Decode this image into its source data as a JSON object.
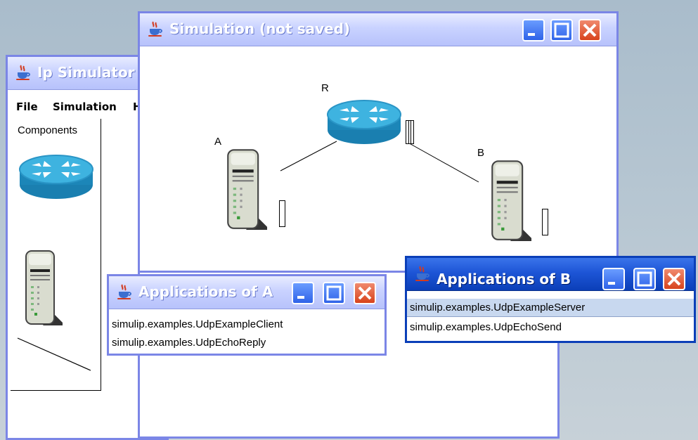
{
  "main_window": {
    "title": "Ip Simulator",
    "menu": [
      "File",
      "Simulation",
      "H"
    ],
    "components_label": "Components"
  },
  "simulation_window": {
    "title": "Simulation (not saved)",
    "nodes": {
      "router": "R",
      "host_a": "A",
      "host_b": "B"
    }
  },
  "apps_a": {
    "title": "Applications of A",
    "items": [
      "simulip.examples.UdpExampleClient",
      "simulip.examples.UdpEchoReply"
    ]
  },
  "apps_b": {
    "title": "Applications of B",
    "items": [
      "simulip.examples.UdpExampleServer",
      "simulip.examples.UdpEchoSend"
    ],
    "selected_index": 0
  },
  "colors": {
    "active_titlebar": "#1d55d6",
    "inactive_titlebar": "#c9d2ff",
    "window_border": "#7b86e6",
    "selection": "#c8d8ef"
  },
  "icons": [
    "java-cup-icon",
    "minimize-icon",
    "maximize-icon",
    "close-icon",
    "router-icon",
    "server-icon"
  ]
}
